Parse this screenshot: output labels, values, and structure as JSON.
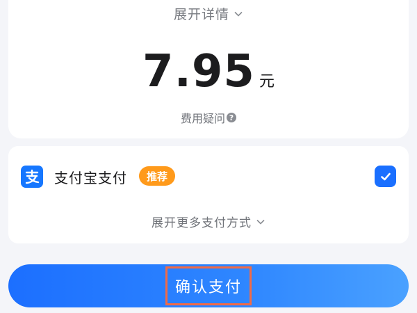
{
  "summary": {
    "expand_details_label": "展开详情",
    "amount": "7.95",
    "currency_unit": "元",
    "fee_question_label": "费用疑问"
  },
  "payment": {
    "method_name": "支付宝支付",
    "badge_label": "推荐",
    "selected": true,
    "more_methods_label": "展开更多支付方式"
  },
  "action": {
    "confirm_label": "确认支付"
  },
  "icons": {
    "expand": "chevron-down-icon",
    "help": "question-circle-icon",
    "payment": "alipay-icon",
    "selected": "checkmark-icon"
  },
  "colors": {
    "accent": "#1a6fff",
    "badge": "#ff9a1b",
    "highlight_border": "#f26a45"
  }
}
